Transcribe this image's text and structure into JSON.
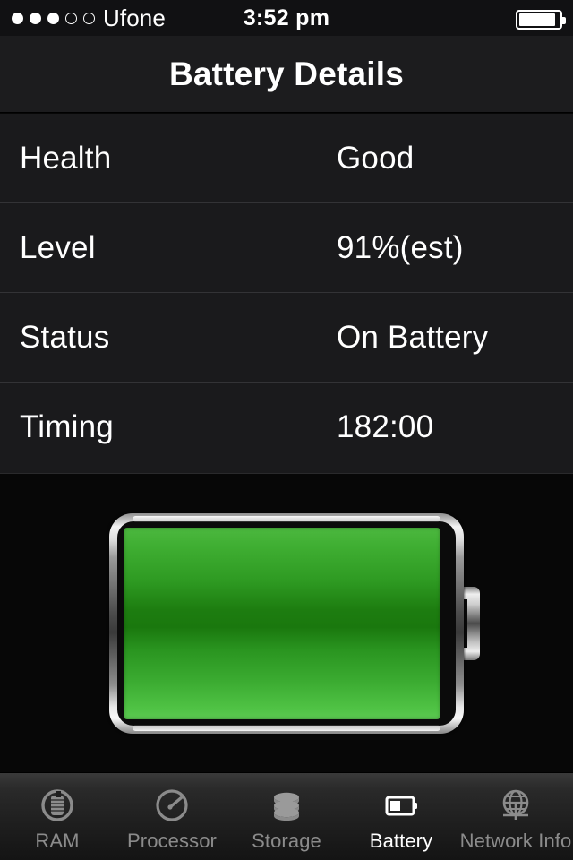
{
  "status_bar": {
    "signal_dots_total": 5,
    "signal_dots_filled": 3,
    "carrier": "Ufone",
    "time": "3:52 pm",
    "battery_icon": "battery-full-icon",
    "battery_fill_percent": 92
  },
  "nav": {
    "title": "Battery Details"
  },
  "details": {
    "rows": [
      {
        "label": "Health",
        "value": "Good"
      },
      {
        "label": "Level",
        "value": "91%(est)"
      },
      {
        "label": "Status",
        "value": "On Battery"
      },
      {
        "label": "Timing",
        "value": "182:00"
      }
    ]
  },
  "battery_graphic": {
    "icon": "battery-large-icon",
    "fill_percent": 91,
    "fill_color": "#2e9a22",
    "shell_color": "#d9d9d9"
  },
  "tab_bar": {
    "active_index": 3,
    "tabs": [
      {
        "label": "RAM",
        "icon": "ram-chip-icon"
      },
      {
        "label": "Processor",
        "icon": "speedometer-icon"
      },
      {
        "label": "Storage",
        "icon": "disk-stack-icon"
      },
      {
        "label": "Battery",
        "icon": "battery-icon"
      },
      {
        "label": "Network Info",
        "icon": "globe-icon"
      }
    ]
  },
  "colors": {
    "background": "#070707",
    "nav_background": "#1c1c1e",
    "table_background": "#1a1a1c",
    "separator": "#333336",
    "text_primary": "#ffffff",
    "text_inactive": "#8b8b8b",
    "battery_green": "#2e9a22"
  }
}
